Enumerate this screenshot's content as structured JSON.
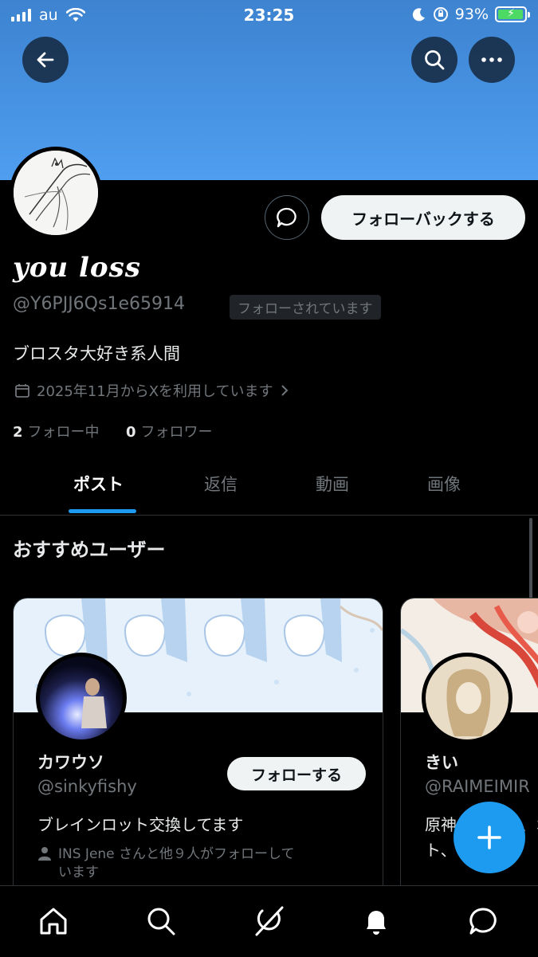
{
  "status_bar": {
    "carrier": "au",
    "time": "23:25",
    "battery": "93%"
  },
  "profile": {
    "display_name": "you loss",
    "handle": "@Y6PJJ6Qs1e65914",
    "follows_you_badge": "フォローされています",
    "bio": "ブロスタ大好き系人間",
    "joined": "2025年11月からXを利用しています",
    "following_count": "2",
    "following_label": "フォロー中",
    "followers_count": "0",
    "followers_label": "フォロワー",
    "follow_back_label": "フォローバックする"
  },
  "tabs": [
    {
      "label": "ポスト",
      "active": true
    },
    {
      "label": "返信",
      "active": false
    },
    {
      "label": "動画",
      "active": false
    },
    {
      "label": "画像",
      "active": false
    }
  ],
  "recommended": {
    "title": "おすすめユーザー",
    "users": [
      {
        "name": "カワウソ",
        "handle": "@sinkyfishy",
        "bio": "ブレインロット交換してます",
        "followed_by_line1": "INS Jene さんと他９人がフォローして",
        "followed_by_line2": "います",
        "follow_label": "フォローする"
      },
      {
        "name": "きい",
        "handle": "@RAIMEIMIR",
        "bio": "原神イラスト、オリスタ",
        "bio_line2": "ト、"
      }
    ]
  },
  "colors": {
    "accent": "#1d9bf0",
    "banner": "#4a96e6",
    "background": "#000000",
    "muted_text": "#71767b"
  },
  "icons": [
    "back-arrow-icon",
    "search-icon",
    "more-icon",
    "message-icon",
    "calendar-icon",
    "chevron-right-icon",
    "person-icon",
    "plus-icon",
    "home-icon",
    "grok-icon",
    "bell-icon",
    "chat-icon"
  ]
}
